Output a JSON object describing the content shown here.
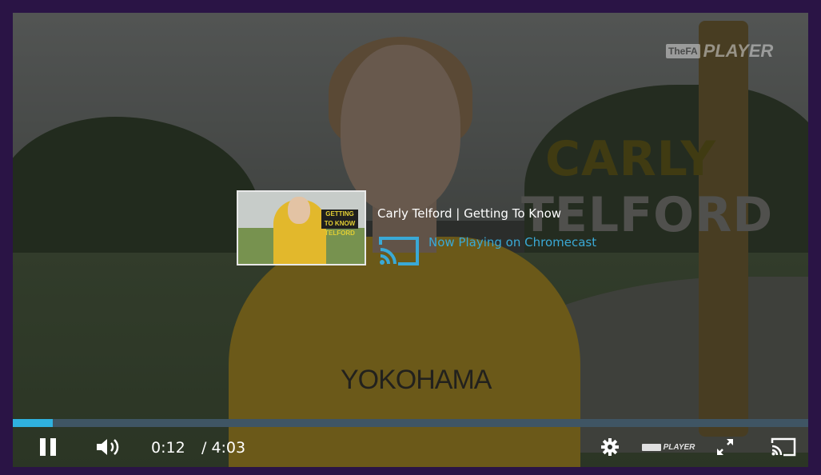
{
  "watermark": {
    "box": "TheFA",
    "word": "PLAYER"
  },
  "overlay_name": {
    "first": "CARLY",
    "last": "TELFORD"
  },
  "cast": {
    "title": "Carly Telford | Getting To Know",
    "status": "Now Playing on Chromecast",
    "thumbnail_title": "GETTING TO KNOW TELFORD"
  },
  "video": {
    "sponsor": "YOKOHAMA"
  },
  "controls": {
    "current_time": "0:12",
    "duration": "/ 4:03",
    "progress": 0.05,
    "player_logo": "PLAYER",
    "icons": {
      "pause": "pause-icon",
      "volume": "volume-icon",
      "settings": "gear-icon",
      "fullscreen": "fullscreen-icon",
      "cast": "cast-icon"
    }
  },
  "colors": {
    "accent": "#2fb1df",
    "frame": "#2a1445",
    "cast_status": "#3aa9d6"
  }
}
